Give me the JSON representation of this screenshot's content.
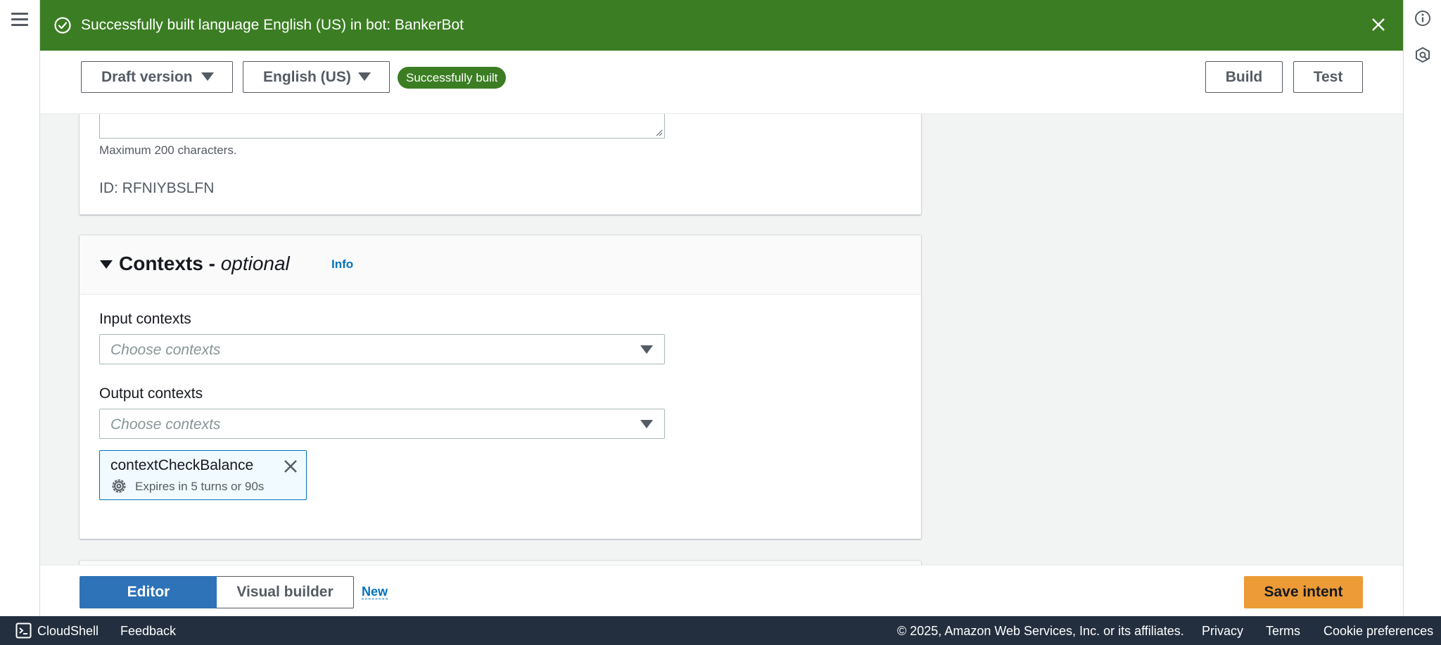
{
  "flash": {
    "message": "Successfully built language English (US) in bot: BankerBot",
    "status_color": "#3b7d23"
  },
  "header": {
    "version_select": "Draft version",
    "language_select": "English (US)",
    "status_badge": "Successfully built",
    "build_label": "Build",
    "test_label": "Test"
  },
  "details_panel": {
    "hint": "Maximum 200 characters.",
    "id_text": "ID: RFNIYBSLFN"
  },
  "contexts_panel": {
    "title": "Contexts -",
    "title_optional": "optional",
    "info_label": "Info",
    "input_label": "Input contexts",
    "input_placeholder": "Choose contexts",
    "output_label": "Output contexts",
    "output_placeholder": "Choose contexts",
    "token": {
      "name": "contextCheckBalance",
      "detail": "Expires in 5 turns or 90s"
    }
  },
  "toolbar": {
    "editor_label": "Editor",
    "visual_builder_label": "Visual builder",
    "new_label": "New",
    "save_label": "Save intent",
    "save_color": "#ec9b36",
    "active_color": "#2e73b8"
  },
  "footer": {
    "cloudshell_label": "CloudShell",
    "feedback_label": "Feedback",
    "copyright": "© 2025, Amazon Web Services, Inc. or its affiliates.",
    "privacy_label": "Privacy",
    "terms_label": "Terms",
    "cookie_label": "Cookie preferences"
  },
  "icons": {
    "menu": "hamburger-menu-icon",
    "info": "info-circle-icon",
    "rail_secondary": "hexagon-tool-icon",
    "success": "check-circle-icon",
    "close": "close-icon",
    "gear": "gear-icon",
    "cloudshell": "terminal-icon"
  }
}
